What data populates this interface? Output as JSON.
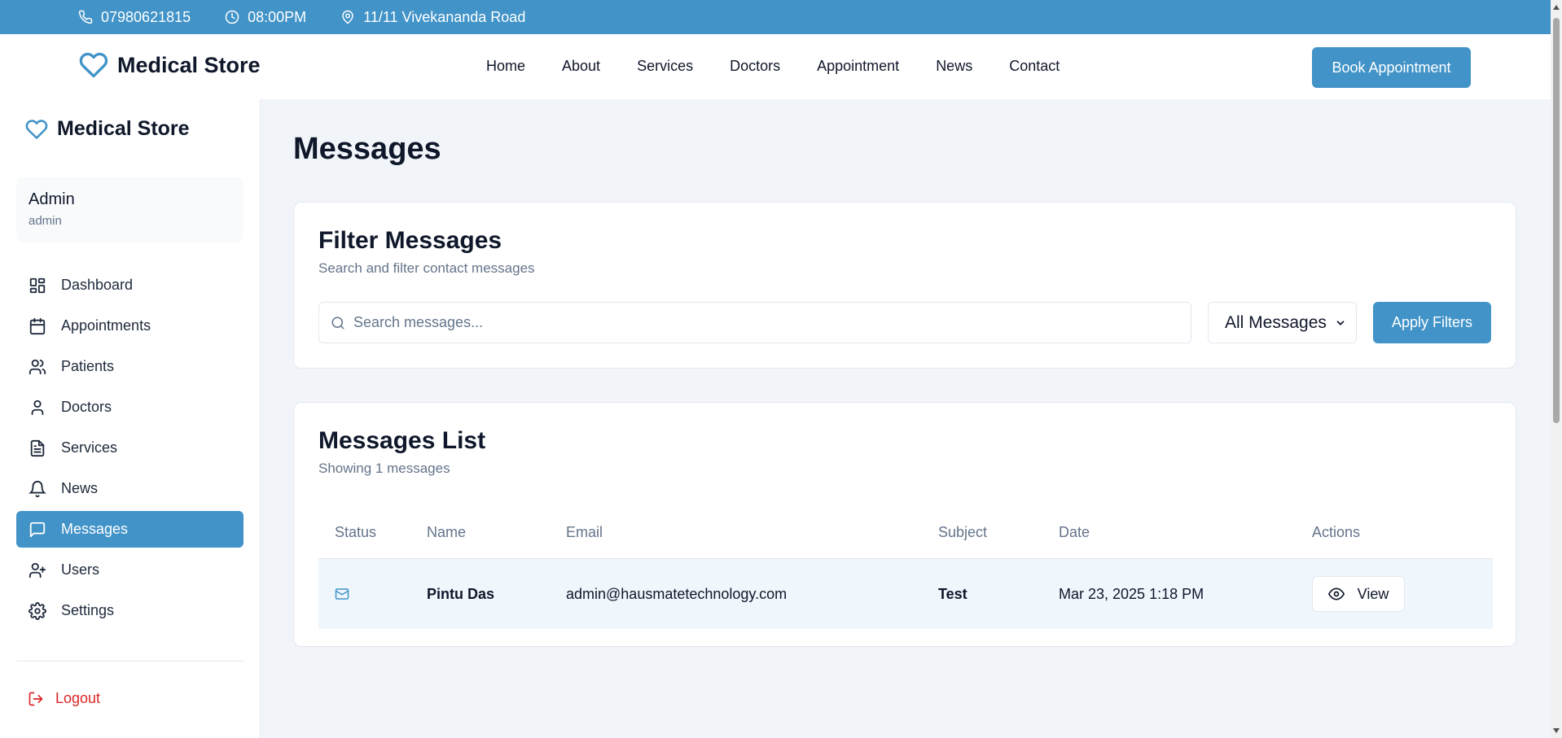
{
  "topbar": {
    "phone": "07980621815",
    "time": "08:00PM",
    "address": "11/11 Vivekananda Road"
  },
  "header": {
    "brand": "Medical Store",
    "nav": [
      "Home",
      "About",
      "Services",
      "Doctors",
      "Appointment",
      "News",
      "Contact"
    ],
    "cta": "Book Appointment"
  },
  "sidebar": {
    "brand": "Medical Store",
    "user": {
      "name": "Admin",
      "role": "admin"
    },
    "items": [
      {
        "label": "Dashboard",
        "icon": "dashboard-icon"
      },
      {
        "label": "Appointments",
        "icon": "calendar-icon"
      },
      {
        "label": "Patients",
        "icon": "users-icon"
      },
      {
        "label": "Doctors",
        "icon": "user-icon"
      },
      {
        "label": "Services",
        "icon": "file-text-icon"
      },
      {
        "label": "News",
        "icon": "bell-icon"
      },
      {
        "label": "Messages",
        "icon": "message-square-icon",
        "active": true
      },
      {
        "label": "Users",
        "icon": "user-plus-icon"
      },
      {
        "label": "Settings",
        "icon": "gear-icon"
      }
    ],
    "logout": "Logout"
  },
  "main": {
    "title": "Messages",
    "filter": {
      "title": "Filter Messages",
      "subtitle": "Search and filter contact messages",
      "search_placeholder": "Search messages...",
      "select_value": "All Messages",
      "apply_label": "Apply Filters"
    },
    "list": {
      "title": "Messages List",
      "subtitle": "Showing 1 messages",
      "columns": [
        "Status",
        "Name",
        "Email",
        "Subject",
        "Date",
        "Actions"
      ],
      "rows": [
        {
          "status_icon": "mail-icon",
          "name": "Pintu Das",
          "email": "admin@hausmatetechnology.com",
          "subject": "Test",
          "date": "Mar 23, 2025 1:18 PM",
          "action": "View"
        }
      ]
    }
  },
  "colors": {
    "primary": "#4193c8",
    "logout": "#dc2626",
    "page_bg": "#f1f5f9",
    "row_bg": "#eff6fc"
  }
}
